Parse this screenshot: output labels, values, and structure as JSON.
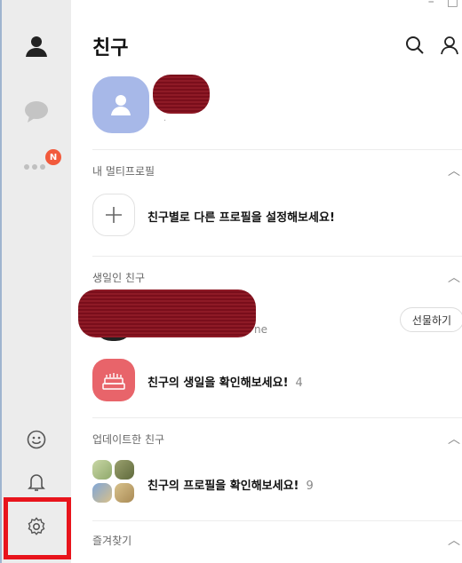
{
  "window": {
    "minimize": "–",
    "maximize": "□"
  },
  "rail": {
    "badge": "N"
  },
  "header": {
    "title": "친구"
  },
  "sections": {
    "multi_profile": {
      "title": "내 멀티프로필",
      "row_text": "친구별로 다른 프로필을 설정해보세요!"
    },
    "birthday": {
      "title": "생일인 친구",
      "name_partial": "ne",
      "gift_button": "선물하기",
      "row_text": "친구의 생일을 확인해보세요!",
      "count": "4"
    },
    "updated": {
      "title": "업데이트한 친구",
      "row_text": "친구의 프로필을 확인해보세요!",
      "count": "9"
    },
    "favorites": {
      "title": "즐겨찾기"
    }
  },
  "colors": {
    "badge": "#f25a3c",
    "avatar": "#a7b8e8",
    "birthday_icon": "#e8646a",
    "highlight": "#e8141c"
  }
}
